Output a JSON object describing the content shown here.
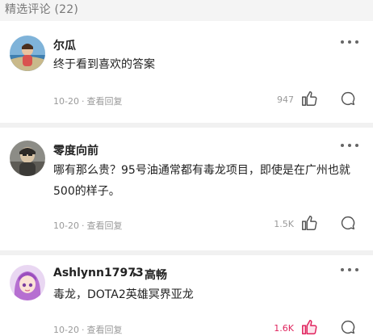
{
  "section": {
    "title": "精选评论 (22)"
  },
  "comments": [
    {
      "author": "尔瓜",
      "reply_to": "",
      "text_lines": [
        "终于看到喜欢的答案"
      ],
      "date": "10-20",
      "view_replies": "查看回复",
      "likes": "947",
      "liked": false
    },
    {
      "author": "零度向前",
      "reply_to": "",
      "text_lines": [
        "哪有那么贵？95号油通常都有毒龙项目，即使是在广州也就",
        "500的样子。"
      ],
      "date": "10-20",
      "view_replies": "查看回复",
      "likes": "1.5K",
      "liked": false
    },
    {
      "author": "Ashlynn17973",
      "reply_to": "高畅",
      "text_lines": [
        "毒龙，DOTA2英雄冥界亚龙"
      ],
      "date": "10-20",
      "view_replies": "查看回复",
      "likes": "1.6K",
      "liked": true
    }
  ],
  "colors": {
    "liked": "#e0245e",
    "meta": "#9a9a9a",
    "divider": "#f1f1f1"
  },
  "icons": [
    "more-icon",
    "thumb-up-icon",
    "reply-bubble-icon",
    "reply-arrow-icon"
  ]
}
